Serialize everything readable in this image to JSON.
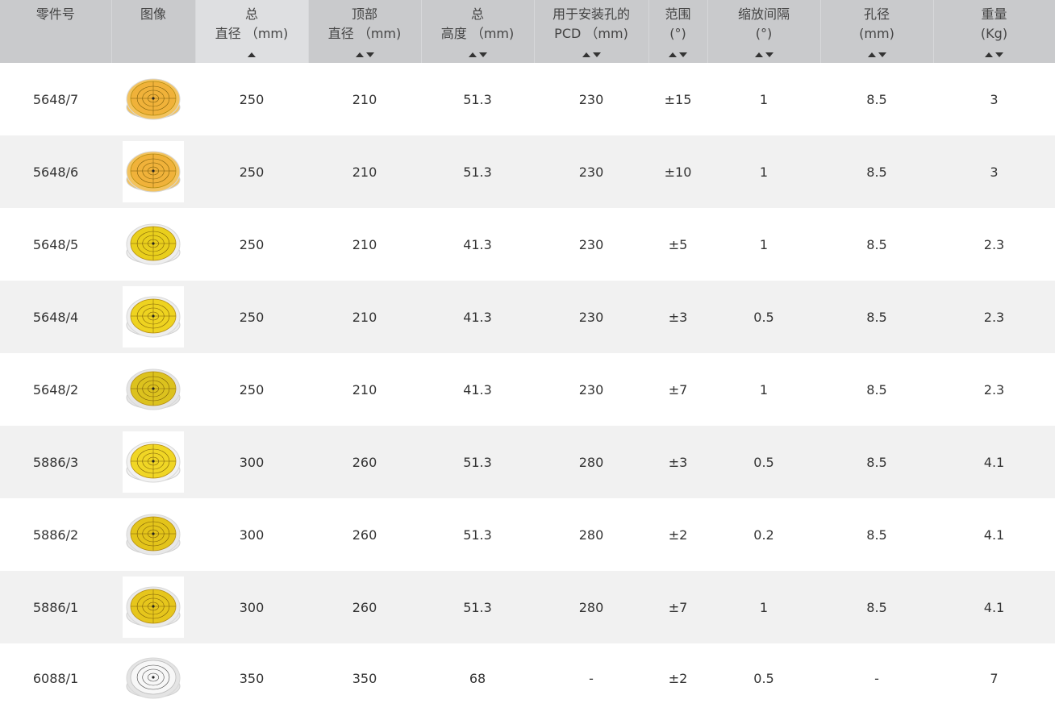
{
  "columns": [
    {
      "lines": [
        "零件号"
      ],
      "sort": "none"
    },
    {
      "lines": [
        "图像"
      ],
      "sort": "none"
    },
    {
      "lines": [
        "总",
        "直径 （mm)"
      ],
      "sort": "asc"
    },
    {
      "lines": [
        "顶部",
        "直径 （mm)"
      ],
      "sort": "both"
    },
    {
      "lines": [
        "总",
        "高度 （mm)"
      ],
      "sort": "both"
    },
    {
      "lines": [
        "用于安装孔的",
        "PCD （mm)"
      ],
      "sort": "both"
    },
    {
      "lines": [
        "范围",
        "(°)"
      ],
      "sort": "both"
    },
    {
      "lines": [
        "缩放间隔",
        "(°)"
      ],
      "sort": "both"
    },
    {
      "lines": [
        "孔径",
        "(mm)"
      ],
      "sort": "both"
    },
    {
      "lines": [
        "重量",
        "(Kg)"
      ],
      "sort": "both"
    }
  ],
  "rows": [
    {
      "part": "5648/7",
      "icon": "orange-bubble-level-icon",
      "face": "#f0b23a",
      "rim": "#f3c35e",
      "d": "250",
      "top": "210",
      "h": "51.3",
      "pcd": "230",
      "range": "±15",
      "scale": "1",
      "hole": "8.5",
      "weight": "3"
    },
    {
      "part": "5648/6",
      "icon": "orange-bubble-level-icon",
      "face": "#f0b23a",
      "rim": "#f3c35e",
      "d": "250",
      "top": "210",
      "h": "51.3",
      "pcd": "230",
      "range": "±10",
      "scale": "1",
      "hole": "8.5",
      "weight": "3"
    },
    {
      "part": "5648/5",
      "icon": "yellow-bubble-level-icon",
      "face": "#e9cf1c",
      "rim": "#eeeeee",
      "d": "250",
      "top": "210",
      "h": "41.3",
      "pcd": "230",
      "range": "±5",
      "scale": "1",
      "hole": "8.5",
      "weight": "2.3"
    },
    {
      "part": "5648/4",
      "icon": "yellow-bubble-level-icon",
      "face": "#eed320",
      "rim": "#eeeeee",
      "d": "250",
      "top": "210",
      "h": "41.3",
      "pcd": "230",
      "range": "±3",
      "scale": "0.5",
      "hole": "8.5",
      "weight": "2.3"
    },
    {
      "part": "5648/2",
      "icon": "yellow-bubble-level-icon",
      "face": "#dcc21e",
      "rim": "#e5e5e5",
      "d": "250",
      "top": "210",
      "h": "41.3",
      "pcd": "230",
      "range": "±7",
      "scale": "1",
      "hole": "8.5",
      "weight": "2.3"
    },
    {
      "part": "5886/3",
      "icon": "yellow-bubble-level-icon",
      "face": "#f0d625",
      "rim": "#f2f2f2",
      "d": "300",
      "top": "260",
      "h": "51.3",
      "pcd": "280",
      "range": "±3",
      "scale": "0.5",
      "hole": "8.5",
      "weight": "4.1"
    },
    {
      "part": "5886/2",
      "icon": "yellow-bubble-level-icon",
      "face": "#e3c41a",
      "rim": "#e8e8e8",
      "d": "300",
      "top": "260",
      "h": "51.3",
      "pcd": "280",
      "range": "±2",
      "scale": "0.2",
      "hole": "8.5",
      "weight": "4.1"
    },
    {
      "part": "5886/1",
      "icon": "yellow-bubble-level-icon",
      "face": "#e6c61c",
      "rim": "#eaeaea",
      "d": "300",
      "top": "260",
      "h": "51.3",
      "pcd": "280",
      "range": "±7",
      "scale": "1",
      "hole": "8.5",
      "weight": "4.1"
    },
    {
      "part": "6088/1",
      "icon": "white-bubble-level-icon",
      "face": "#f7f7f7",
      "rim": "#e4e4e4",
      "d": "350",
      "top": "350",
      "h": "68",
      "pcd": "-",
      "range": "±2",
      "scale": "0.5",
      "hole": "-",
      "weight": "7"
    }
  ]
}
